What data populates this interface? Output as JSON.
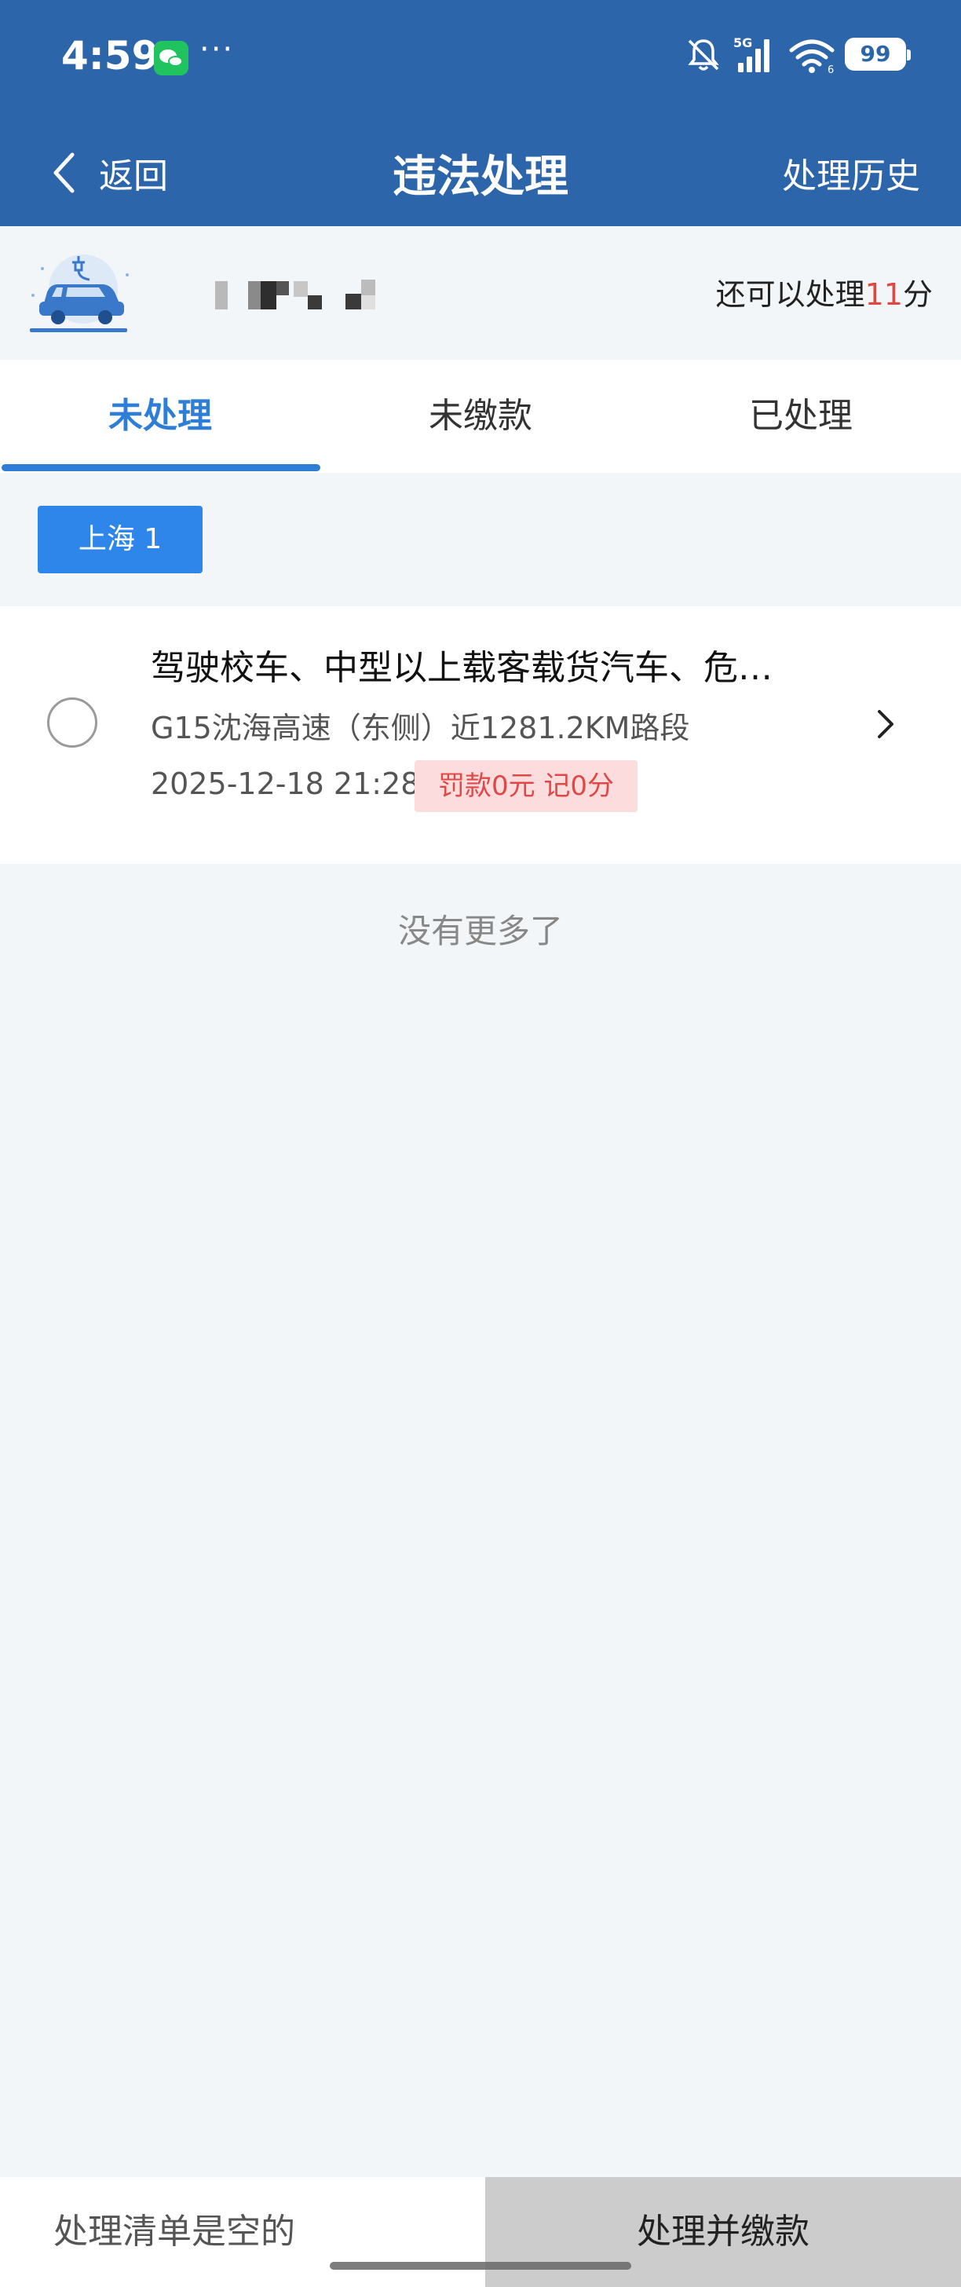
{
  "status_bar": {
    "time": "4:59",
    "more": "···",
    "network": "5G",
    "battery": "99"
  },
  "nav": {
    "back_label": "返回",
    "title": "违法处理",
    "history_label": "处理历史"
  },
  "vehicle": {
    "points_prefix": "还可以处理",
    "points_value": "11",
    "points_suffix": "分"
  },
  "tabs": [
    {
      "label": "未处理",
      "active": true
    },
    {
      "label": "未缴款",
      "active": false
    },
    {
      "label": "已处理",
      "active": false
    }
  ],
  "region_chip": "上海 1",
  "violations": [
    {
      "title": "驾驶校车、中型以上载客载货汽车、危…",
      "location": "G15沈海高速（东侧）近1281.2KM路段",
      "time": "2025-12-18 21:28",
      "fine": "罚款0元 记0分"
    }
  ],
  "no_more": "没有更多了",
  "bottom": {
    "empty_text": "处理清单是空的",
    "pay_button": "处理并缴款"
  },
  "colors": {
    "header": "#2c65aa",
    "accent": "#2e7ed8",
    "fine_bg": "#fcdcdc",
    "fine_text": "#e04848"
  }
}
